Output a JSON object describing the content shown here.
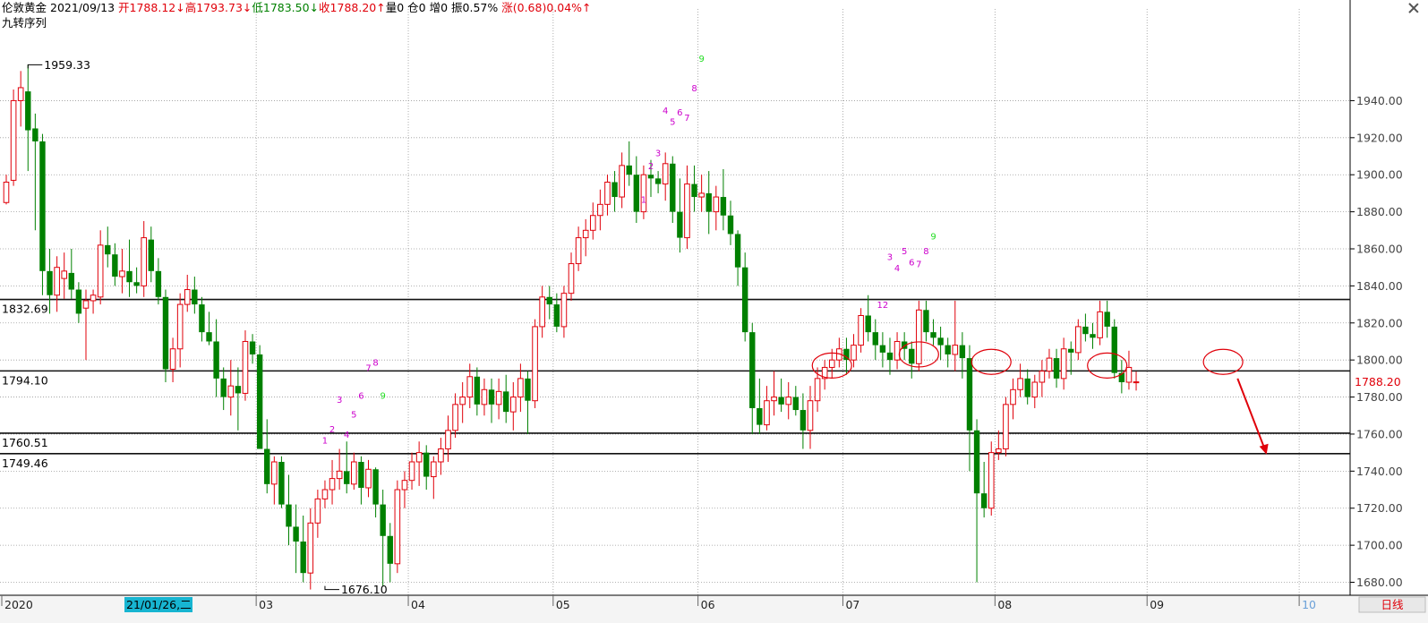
{
  "header": {
    "instrument": "伦敦黄金",
    "date": "2021/09/13",
    "open": "开1788.12↓",
    "high": "高1793.73↓",
    "low": "低1783.50↓",
    "close": "收1788.20↑",
    "volume": "量0",
    "position": "仓0",
    "increase": "增0",
    "amplitude": "振0.57%",
    "change": "涨(0.68)0.04%↑",
    "indicator": "九转序列"
  },
  "footer": {
    "period_button": "日线",
    "date_highlight": "21/01/26,二"
  },
  "colors": {
    "up": "#e0000a",
    "down": "#008000",
    "td_setup": "#cc00cc",
    "td_nine": "#22dd22",
    "annotation": "#e0000a",
    "grid": "#9a9a9a"
  },
  "chart_data": {
    "type": "candlestick",
    "ylim": [
      1673,
      1975
    ],
    "yticks": [
      "1680.00",
      "1700.00",
      "1720.00",
      "1740.00",
      "1760.00",
      "1780.00",
      "1800.00",
      "1820.00",
      "1840.00",
      "1860.00",
      "1880.00",
      "1900.00",
      "1920.00",
      "1940.00"
    ],
    "x_axis": [
      {
        "label": "2020",
        "i": 0
      },
      {
        "label": "03",
        "i": 35
      },
      {
        "label": "04",
        "i": 56
      },
      {
        "label": "05",
        "i": 76
      },
      {
        "label": "06",
        "i": 96
      },
      {
        "label": "07",
        "i": 116
      },
      {
        "label": "08",
        "i": 137
      },
      {
        "label": "09",
        "i": 158
      },
      {
        "label": "10",
        "i": 179
      }
    ],
    "last_price": "1788.20",
    "horizontal_lines": [
      {
        "value": 1832.69,
        "label": "1832.69"
      },
      {
        "value": 1794.1,
        "label": "1794.10"
      },
      {
        "value": 1760.51,
        "label": "1760.51"
      },
      {
        "value": 1749.46,
        "label": "1749.46"
      }
    ],
    "extremes": [
      {
        "label": "1959.33",
        "value": 1959.33,
        "i": 3
      },
      {
        "label": "1676.10",
        "value": 1676.1,
        "i": 44
      }
    ],
    "td_labels": [
      {
        "text": "1",
        "i": 44,
        "value": 1755
      },
      {
        "text": "2",
        "i": 45,
        "value": 1761
      },
      {
        "text": "3",
        "i": 46,
        "value": 1777
      },
      {
        "text": "4",
        "i": 47,
        "value": 1758
      },
      {
        "text": "5",
        "i": 48,
        "value": 1769
      },
      {
        "text": "6",
        "i": 49,
        "value": 1779
      },
      {
        "text": "7",
        "i": 50,
        "value": 1794
      },
      {
        "text": "8",
        "i": 51,
        "value": 1797
      },
      {
        "text": "9",
        "i": 52,
        "value": 1779
      },
      {
        "text": "1",
        "i": 88,
        "value": 1885
      },
      {
        "text": "2",
        "i": 89,
        "value": 1903
      },
      {
        "text": "3",
        "i": 90,
        "value": 1910
      },
      {
        "text": "4",
        "i": 91,
        "value": 1933
      },
      {
        "text": "5",
        "i": 92,
        "value": 1927
      },
      {
        "text": "6",
        "i": 93,
        "value": 1932
      },
      {
        "text": "7",
        "i": 94,
        "value": 1929
      },
      {
        "text": "8",
        "i": 95,
        "value": 1945
      },
      {
        "text": "9",
        "i": 96,
        "value": 1961
      },
      {
        "text": "12",
        "i": 121,
        "value": 1828
      },
      {
        "text": "3",
        "i": 122,
        "value": 1854
      },
      {
        "text": "4",
        "i": 123,
        "value": 1848
      },
      {
        "text": "5",
        "i": 124,
        "value": 1857
      },
      {
        "text": "6",
        "i": 125,
        "value": 1851
      },
      {
        "text": "7",
        "i": 126,
        "value": 1850
      },
      {
        "text": "8",
        "i": 127,
        "value": 1857
      },
      {
        "text": "9",
        "i": 128,
        "value": 1865
      }
    ],
    "annotations": {
      "ellipses": [
        {
          "i": 114,
          "value": 1797
        },
        {
          "i": 126,
          "value": 1803
        },
        {
          "i": 136,
          "value": 1799
        },
        {
          "i": 152,
          "value": 1797
        },
        {
          "i": 168,
          "value": 1799
        }
      ],
      "arrow": {
        "from_i": 170,
        "from_value": 1790,
        "to_i": 174,
        "to_value": 1749
      }
    },
    "candles": [
      [
        1885,
        1900,
        1884,
        1896
      ],
      [
        1897,
        1946,
        1894,
        1940
      ],
      [
        1940,
        1956,
        1926,
        1947
      ],
      [
        1945,
        1959.33,
        1902,
        1924
      ],
      [
        1925,
        1933,
        1870,
        1918
      ],
      [
        1918,
        1922,
        1835,
        1848
      ],
      [
        1848,
        1860,
        1825,
        1835
      ],
      [
        1835,
        1856,
        1826,
        1850
      ],
      [
        1844,
        1858,
        1833,
        1848
      ],
      [
        1847,
        1860,
        1833,
        1838
      ],
      [
        1838,
        1842,
        1820,
        1825
      ],
      [
        1828,
        1838,
        1800,
        1832
      ],
      [
        1832,
        1838,
        1825,
        1835
      ],
      [
        1834,
        1870,
        1830,
        1862
      ],
      [
        1862,
        1872,
        1850,
        1857
      ],
      [
        1857,
        1863,
        1840,
        1845
      ],
      [
        1845,
        1860,
        1836,
        1848
      ],
      [
        1848,
        1865,
        1834,
        1842
      ],
      [
        1842,
        1850,
        1836,
        1840
      ],
      [
        1840,
        1875,
        1834,
        1866
      ],
      [
        1865,
        1872,
        1842,
        1848
      ],
      [
        1848,
        1855,
        1830,
        1834
      ],
      [
        1834,
        1838,
        1788,
        1795
      ],
      [
        1795,
        1812,
        1788,
        1806
      ],
      [
        1806,
        1836,
        1796,
        1830
      ],
      [
        1830,
        1846,
        1826,
        1838
      ],
      [
        1838,
        1845,
        1825,
        1830
      ],
      [
        1830,
        1834,
        1810,
        1815
      ],
      [
        1815,
        1826,
        1808,
        1810
      ],
      [
        1810,
        1822,
        1780,
        1790
      ],
      [
        1790,
        1796,
        1773,
        1780
      ],
      [
        1780,
        1800,
        1770,
        1786
      ],
      [
        1786,
        1796,
        1762,
        1782
      ],
      [
        1782,
        1816,
        1778,
        1810
      ],
      [
        1810,
        1814,
        1798,
        1803
      ],
      [
        1803,
        1808,
        1754,
        1752
      ],
      [
        1752,
        1768,
        1728,
        1733
      ],
      [
        1733,
        1748,
        1722,
        1745
      ],
      [
        1745,
        1748,
        1720,
        1722
      ],
      [
        1722,
        1738,
        1700,
        1710
      ],
      [
        1710,
        1722,
        1685,
        1702
      ],
      [
        1702,
        1716,
        1680,
        1685
      ],
      [
        1685,
        1720,
        1676.1,
        1712
      ],
      [
        1712,
        1730,
        1704,
        1725
      ],
      [
        1725,
        1735,
        1720,
        1730
      ],
      [
        1730,
        1746,
        1722,
        1736
      ],
      [
        1736,
        1752,
        1730,
        1740
      ],
      [
        1740,
        1756,
        1728,
        1733
      ],
      [
        1733,
        1750,
        1730,
        1745
      ],
      [
        1745,
        1748,
        1722,
        1731
      ],
      [
        1731,
        1746,
        1726,
        1741
      ],
      [
        1741,
        1742,
        1715,
        1722
      ],
      [
        1722,
        1730,
        1678,
        1705
      ],
      [
        1705,
        1712,
        1680,
        1690
      ],
      [
        1690,
        1735,
        1685,
        1730
      ],
      [
        1730,
        1740,
        1720,
        1735
      ],
      [
        1735,
        1750,
        1730,
        1745
      ],
      [
        1745,
        1756,
        1732,
        1750
      ],
      [
        1750,
        1754,
        1730,
        1737
      ],
      [
        1737,
        1748,
        1725,
        1745
      ],
      [
        1745,
        1758,
        1738,
        1752
      ],
      [
        1752,
        1770,
        1745,
        1762
      ],
      [
        1762,
        1782,
        1758,
        1776
      ],
      [
        1776,
        1788,
        1766,
        1780
      ],
      [
        1780,
        1798,
        1774,
        1791
      ],
      [
        1791,
        1796,
        1770,
        1776
      ],
      [
        1776,
        1790,
        1770,
        1784
      ],
      [
        1784,
        1790,
        1766,
        1776
      ],
      [
        1776,
        1790,
        1768,
        1783
      ],
      [
        1783,
        1792,
        1766,
        1772
      ],
      [
        1772,
        1788,
        1762,
        1780
      ],
      [
        1780,
        1798,
        1772,
        1790
      ],
      [
        1790,
        1794,
        1760,
        1778
      ],
      [
        1778,
        1822,
        1774,
        1818
      ],
      [
        1818,
        1840,
        1812,
        1834
      ],
      [
        1834,
        1840,
        1822,
        1830
      ],
      [
        1830,
        1836,
        1815,
        1818
      ],
      [
        1818,
        1840,
        1812,
        1836
      ],
      [
        1836,
        1858,
        1832,
        1852
      ],
      [
        1852,
        1872,
        1848,
        1866
      ],
      [
        1866,
        1876,
        1856,
        1870
      ],
      [
        1870,
        1885,
        1865,
        1878
      ],
      [
        1878,
        1892,
        1870,
        1884
      ],
      [
        1884,
        1900,
        1878,
        1896
      ],
      [
        1896,
        1902,
        1880,
        1888
      ],
      [
        1888,
        1912,
        1882,
        1905
      ],
      [
        1905,
        1918,
        1894,
        1900
      ],
      [
        1900,
        1910,
        1874,
        1880
      ],
      [
        1880,
        1905,
        1876,
        1900
      ],
      [
        1900,
        1908,
        1888,
        1898
      ],
      [
        1898,
        1902,
        1890,
        1895
      ],
      [
        1895,
        1912,
        1886,
        1906
      ],
      [
        1906,
        1910,
        1874,
        1880
      ],
      [
        1880,
        1898,
        1858,
        1866
      ],
      [
        1866,
        1905,
        1860,
        1895
      ],
      [
        1895,
        1905,
        1880,
        1888
      ],
      [
        1888,
        1900,
        1880,
        1890
      ],
      [
        1890,
        1902,
        1868,
        1880
      ],
      [
        1880,
        1894,
        1870,
        1888
      ],
      [
        1888,
        1903,
        1870,
        1878
      ],
      [
        1878,
        1886,
        1862,
        1868
      ],
      [
        1868,
        1870,
        1840,
        1850
      ],
      [
        1850,
        1858,
        1810,
        1815
      ],
      [
        1815,
        1820,
        1760,
        1774
      ],
      [
        1774,
        1790,
        1760,
        1765
      ],
      [
        1765,
        1786,
        1762,
        1778
      ],
      [
        1778,
        1794,
        1770,
        1780
      ],
      [
        1780,
        1790,
        1772,
        1776
      ],
      [
        1776,
        1788,
        1768,
        1780
      ],
      [
        1780,
        1786,
        1770,
        1773
      ],
      [
        1773,
        1782,
        1752,
        1762
      ],
      [
        1762,
        1786,
        1752,
        1778
      ],
      [
        1778,
        1796,
        1772,
        1790
      ],
      [
        1790,
        1800,
        1784,
        1796
      ],
      [
        1796,
        1806,
        1790,
        1800
      ],
      [
        1800,
        1812,
        1796,
        1806
      ],
      [
        1806,
        1812,
        1792,
        1800
      ],
      [
        1800,
        1814,
        1796,
        1808
      ],
      [
        1808,
        1828,
        1804,
        1824
      ],
      [
        1824,
        1835,
        1810,
        1815
      ],
      [
        1815,
        1822,
        1800,
        1808
      ],
      [
        1808,
        1815,
        1796,
        1804
      ],
      [
        1804,
        1812,
        1792,
        1800
      ],
      [
        1800,
        1815,
        1795,
        1810
      ],
      [
        1810,
        1815,
        1800,
        1806
      ],
      [
        1806,
        1810,
        1790,
        1798
      ],
      [
        1798,
        1832,
        1794,
        1827
      ],
      [
        1827,
        1832,
        1810,
        1815
      ],
      [
        1815,
        1822,
        1808,
        1812
      ],
      [
        1812,
        1818,
        1800,
        1808
      ],
      [
        1808,
        1812,
        1796,
        1803
      ],
      [
        1803,
        1832,
        1794,
        1808
      ],
      [
        1808,
        1815,
        1790,
        1801
      ],
      [
        1801,
        1808,
        1740,
        1762
      ],
      [
        1762,
        1768,
        1680,
        1728
      ],
      [
        1728,
        1745,
        1715,
        1720
      ],
      [
        1720,
        1756,
        1716,
        1750
      ],
      [
        1750,
        1762,
        1746,
        1752
      ],
      [
        1752,
        1780,
        1748,
        1776
      ],
      [
        1776,
        1790,
        1768,
        1784
      ],
      [
        1784,
        1798,
        1780,
        1790
      ],
      [
        1790,
        1795,
        1776,
        1780
      ],
      [
        1780,
        1792,
        1774,
        1788
      ],
      [
        1788,
        1800,
        1780,
        1794
      ],
      [
        1794,
        1806,
        1790,
        1801
      ],
      [
        1801,
        1806,
        1785,
        1790
      ],
      [
        1790,
        1812,
        1784,
        1806
      ],
      [
        1806,
        1810,
        1792,
        1804
      ],
      [
        1804,
        1822,
        1800,
        1818
      ],
      [
        1818,
        1825,
        1810,
        1814
      ],
      [
        1814,
        1820,
        1806,
        1812
      ],
      [
        1812,
        1832,
        1808,
        1826
      ],
      [
        1826,
        1832,
        1812,
        1818
      ],
      [
        1818,
        1822,
        1790,
        1793
      ],
      [
        1793,
        1800,
        1782,
        1788
      ],
      [
        1788,
        1805,
        1784,
        1796
      ],
      [
        1788.12,
        1793.73,
        1783.5,
        1788.2
      ]
    ]
  }
}
